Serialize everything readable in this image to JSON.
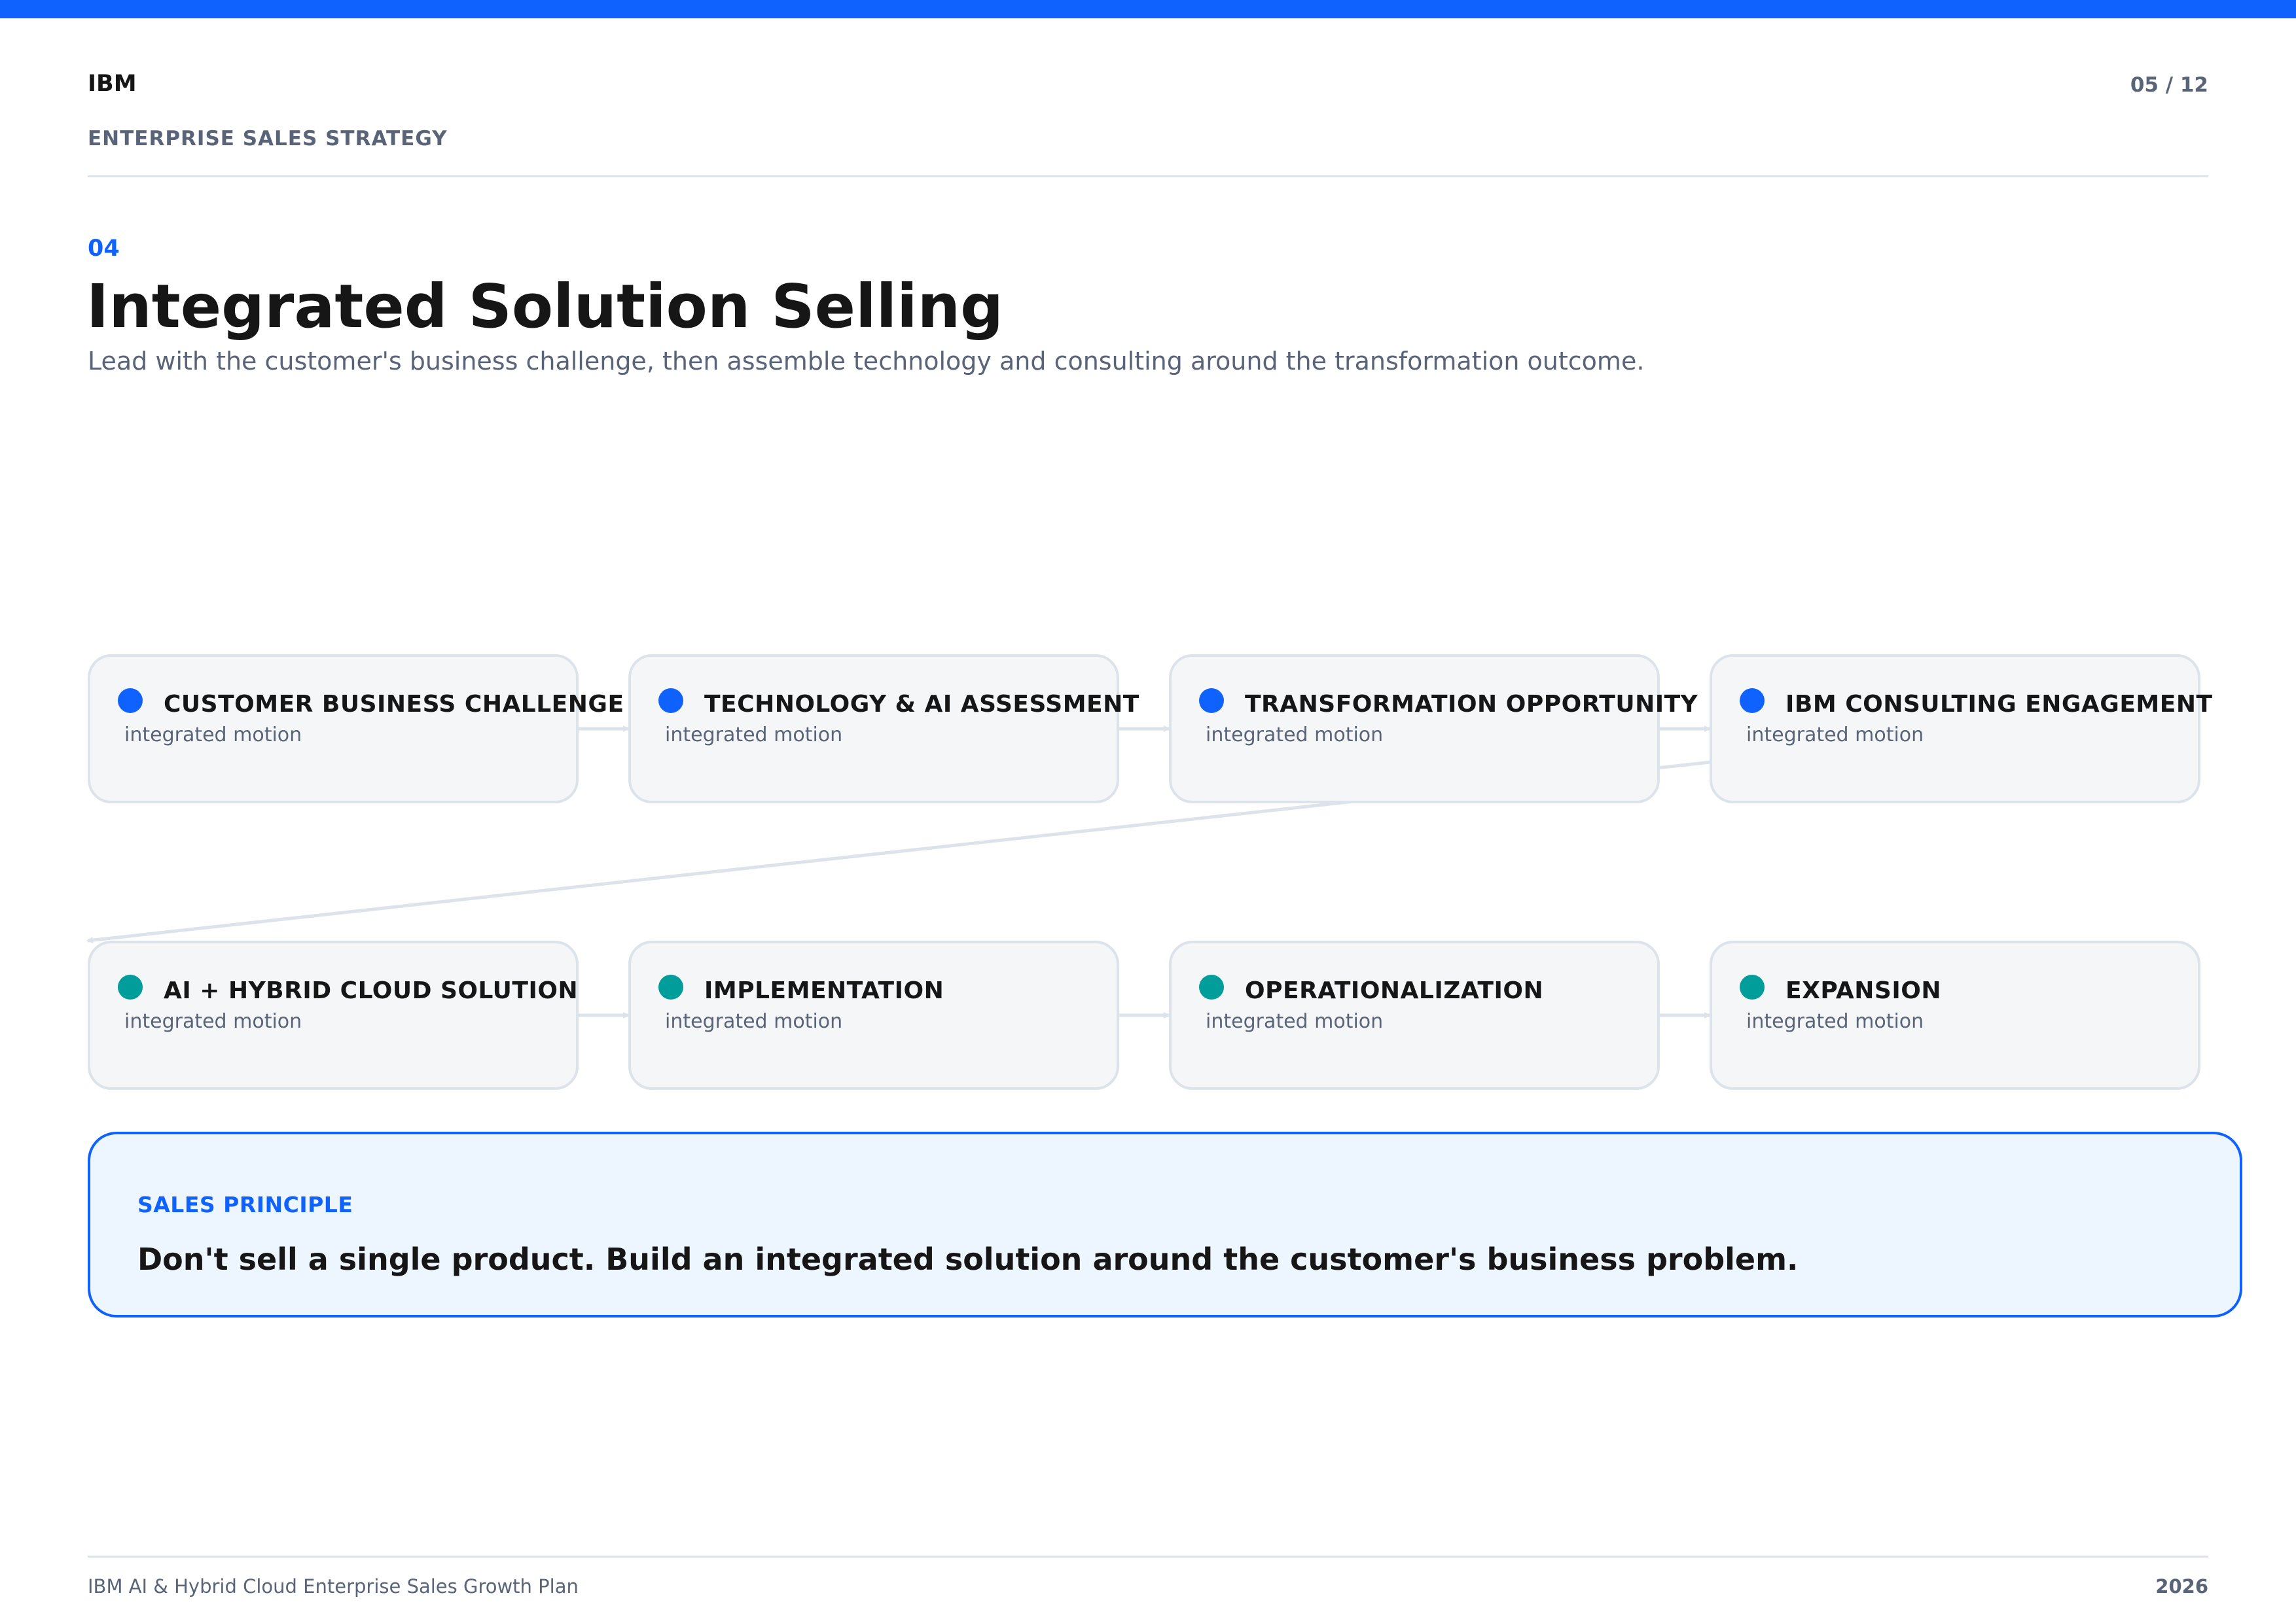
{
  "header": {
    "brand": "IBM",
    "page_indicator": "05 / 12",
    "deck_subtitle": "ENTERPRISE SALES STRATEGY"
  },
  "section": {
    "number": "04",
    "title": "Integrated Solution Selling",
    "subtitle": "Lead with the customer's business challenge, then assemble technology and consulting around the transformation outcome."
  },
  "flow": {
    "steps": [
      {
        "label": "CUSTOMER BUSINESS CHALLENGE",
        "desc": "integrated motion",
        "color": "#0f62fe"
      },
      {
        "label": "TECHNOLOGY & AI ASSESSMENT",
        "desc": "integrated motion",
        "color": "#0f62fe"
      },
      {
        "label": "TRANSFORMATION OPPORTUNITY",
        "desc": "integrated motion",
        "color": "#0f62fe"
      },
      {
        "label": "IBM CONSULTING ENGAGEMENT",
        "desc": "integrated motion",
        "color": "#0f62fe"
      },
      {
        "label": "AI + HYBRID CLOUD SOLUTION",
        "desc": "integrated motion",
        "color": "#009d9a"
      },
      {
        "label": "IMPLEMENTATION",
        "desc": "integrated motion",
        "color": "#009d9a"
      },
      {
        "label": "OPERATIONALIZATION",
        "desc": "integrated motion",
        "color": "#009d9a"
      },
      {
        "label": "EXPANSION",
        "desc": "integrated motion",
        "color": "#009d9a"
      }
    ],
    "connector_color": "#dde3ea"
  },
  "principle": {
    "label": "SALES PRINCIPLE",
    "text": "Don't sell a single product. Build an integrated solution around the customer's business problem."
  },
  "footer": {
    "left": "IBM AI & Hybrid Cloud Enterprise Sales Growth Plan",
    "right": "2026"
  },
  "colors": {
    "accent": "#0f62fe",
    "teal": "#009d9a",
    "muted": "#5a6478",
    "card_bg": "#f4f6f8",
    "principle_bg": "#edf5ff"
  }
}
